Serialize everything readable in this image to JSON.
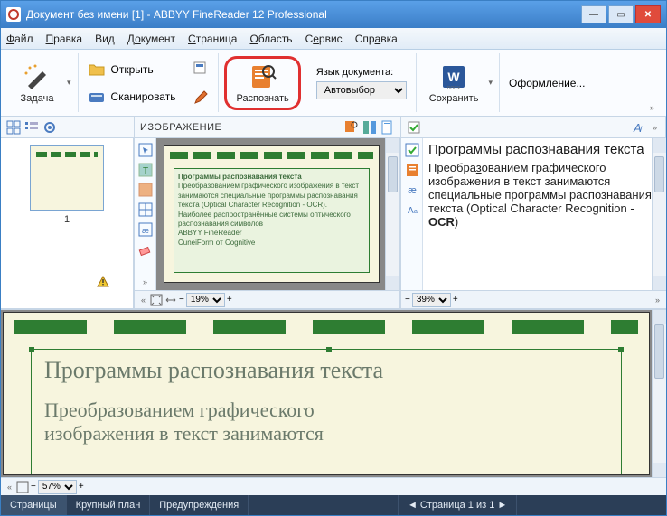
{
  "window": {
    "title": "Документ без имени [1] - ABBYY FineReader 12 Professional"
  },
  "menu": {
    "file": "Файл",
    "edit": "Правка",
    "view": "Вид",
    "document": "Документ",
    "page": "Страница",
    "area": "Область",
    "service": "Сервис",
    "help": "Справка"
  },
  "ribbon": {
    "task": "Задача",
    "open": "Открыть",
    "scan": "Сканировать",
    "recognize": "Распознать",
    "lang_label": "Язык документа:",
    "lang_value": "Автовыбор",
    "save": "Сохранить",
    "format": "Оформление..."
  },
  "panes": {
    "image_title": "ИЗОБРАЖЕНИЕ",
    "thumb_label": "1",
    "zoom_image": "19%",
    "zoom_text": "39%",
    "zoom_lower": "57%"
  },
  "doc_text": {
    "small_title": "Программы распознавания текста",
    "small_body": "Преобразованием графического изображения в текст занимаются специальные программы распознавания текста (Optical Character Recognition - OCR).\nНаиболее распространённые системы оптического распознавания символов\nABBYY FineReader\nCuneiForm от Cognitive",
    "text_h1": "Программы распознавания текста",
    "text_body1": "Преобра",
    "text_body1b": "з",
    "text_body2": "ованием графического изображения в текст занимаются специальные программы распознавания текста (Optical Character Recognition -",
    "text_body3": "OCR",
    "text_body4": ")",
    "lower_t1": "Программы распознавания текста",
    "lower_t2a": "Преобразованием графического",
    "lower_t2b": "изображения в текст занимаются"
  },
  "status": {
    "pages": "Страницы",
    "closeup": "Крупный план",
    "warnings": "Предупреждения",
    "page_of": "Страница 1 из 1"
  }
}
